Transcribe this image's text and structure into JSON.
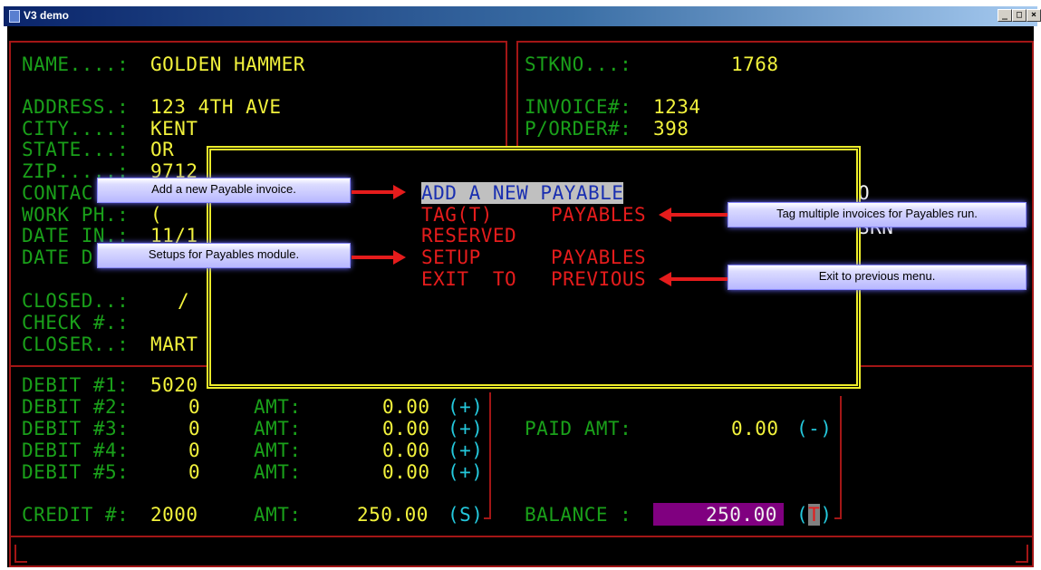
{
  "window": {
    "title": "V3 demo",
    "minimize": "_",
    "maximize": "□",
    "close": "×"
  },
  "customer": {
    "name_label": "NAME....:",
    "name_value": "GOLDEN HAMMER",
    "address_label": "ADDRESS.:",
    "address_value": "123 4TH AVE",
    "city_label": "CITY....:",
    "city_value": "KENT",
    "state_label": "STATE...:",
    "state_value": "OR",
    "zip_label": "ZIP.....:",
    "zip_value": "9712",
    "contact_label": "CONTAC",
    "workph_label": "WORK PH.:",
    "workph_value": "(",
    "datein_label": "DATE IN.:",
    "datein_value": "11/1",
    "date_label": "DATE D",
    "closed_label": "CLOSED..:",
    "closed_value": "/",
    "check_label": "CHECK #.:",
    "closer_label": "CLOSER..:",
    "closer_value": "MART"
  },
  "invoice": {
    "stkno_label": "STKNO...:",
    "stkno_value": "1768",
    "invoice_label": "INVOICE#:",
    "invoice_value": "1234",
    "porder_label": "P/ORDER#:",
    "porder_value": "398",
    "right_frag1": "O",
    "right_frag2": "SRN"
  },
  "menu": {
    "items": [
      {
        "text": "ADD A NEW PAYABLE"
      },
      {
        "left": "TAG(T)",
        "right": "PAYABLES"
      },
      {
        "left": "RESERVED"
      },
      {
        "left": "SETUP",
        "right": "PAYABLES"
      },
      {
        "left": "EXIT  TO",
        "right": "PREVIOUS"
      }
    ]
  },
  "callouts": {
    "add": "Add a new Payable invoice.",
    "tag": "Tag multiple invoices for Payables run.",
    "setup": "Setups for Payables module.",
    "exit": "Exit to previous menu."
  },
  "ledger": {
    "debit1_label": "DEBIT #1:",
    "debit1_acct": "5020",
    "rows": [
      {
        "label": "DEBIT #2:",
        "acct": "0",
        "amt_label": "AMT:",
        "amt": "0.00",
        "sign": "(+)"
      },
      {
        "label": "DEBIT #3:",
        "acct": "0",
        "amt_label": "AMT:",
        "amt": "0.00",
        "sign": "(+)"
      },
      {
        "label": "DEBIT #4:",
        "acct": "0",
        "amt_label": "AMT:",
        "amt": "0.00",
        "sign": "(+)"
      },
      {
        "label": "DEBIT #5:",
        "acct": "0",
        "amt_label": "AMT:",
        "amt": "0.00",
        "sign": "(+)"
      }
    ],
    "credit_label": "CREDIT #:",
    "credit_acct": "2000",
    "credit_amt_label": "AMT:",
    "credit_amt": "250.00",
    "credit_sign": "(S)",
    "paid_label": "PAID AMT:",
    "paid_amt": "0.00",
    "paid_sign": "(-)",
    "balance_label": "BALANCE :",
    "balance_amt": "250.00",
    "balance_sign_open": "(",
    "balance_sign_t": "T",
    "balance_sign_close": ")"
  },
  "colors": {
    "label": "#1aa01a",
    "value": "#f2f23c",
    "menu": "#e51c1c",
    "sign": "#24c8dc",
    "border": "#a31616",
    "dialog_border": "#ecec2a"
  }
}
